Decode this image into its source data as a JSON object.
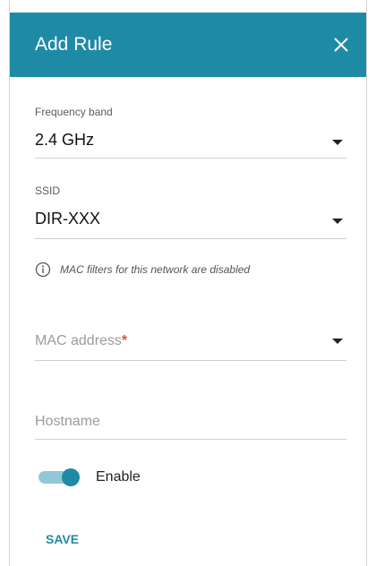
{
  "dialog": {
    "title": "Add Rule",
    "close_icon": "close-icon"
  },
  "frequency_band": {
    "label": "Frequency band",
    "value": "2.4 GHz"
  },
  "ssid": {
    "label": "SSID",
    "value": "DIR-XXX"
  },
  "info": {
    "icon": "info-icon",
    "text": "MAC filters for this network are disabled"
  },
  "mac_address": {
    "placeholder": "MAC address",
    "required_mark": "*"
  },
  "hostname": {
    "placeholder": "Hostname"
  },
  "enable_toggle": {
    "label": "Enable",
    "on": true
  },
  "actions": {
    "save_label": "SAVE"
  },
  "colors": {
    "accent": "#1f8aa6",
    "accent_light": "#8fc8d8",
    "required": "#d9534f"
  }
}
